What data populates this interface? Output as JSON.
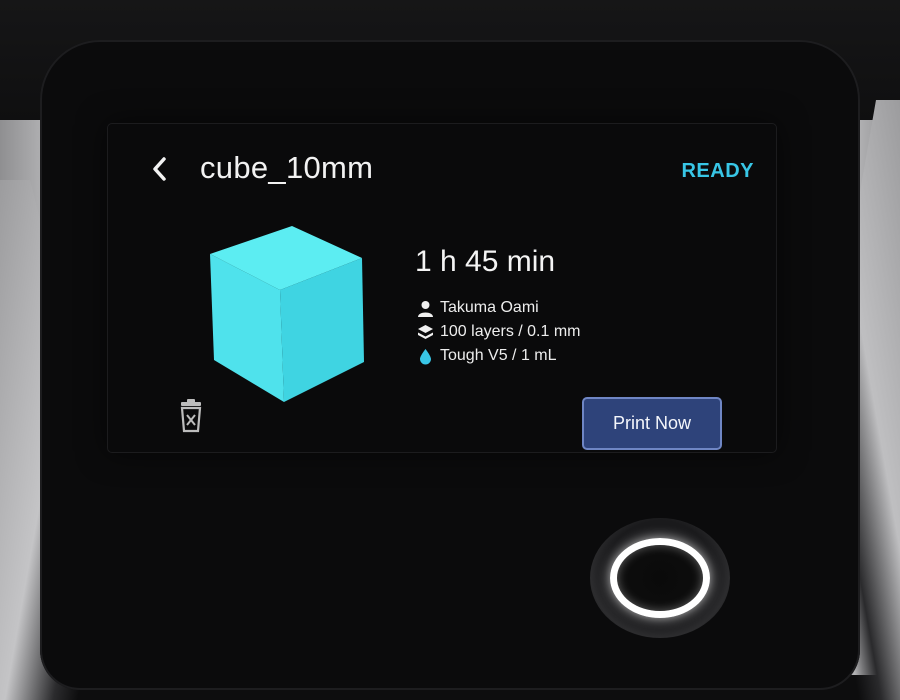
{
  "screen": {
    "title": "cube_10mm",
    "status": "READY",
    "status_color": "#38c6e6",
    "back_icon": "chevron-left-icon",
    "preview": {
      "shape": "cube",
      "color": "#4fe4ee"
    },
    "trash_icon": "trash-icon",
    "print_time": "1 h 45 min",
    "details": [
      {
        "icon": "user-icon",
        "text": "Takuma Oami"
      },
      {
        "icon": "layers-icon",
        "text": "100 layers / 0.1 mm"
      },
      {
        "icon": "droplet-icon",
        "text": "Tough V5 / 1 mL"
      }
    ],
    "print_button_label": "Print Now"
  },
  "hardware": {
    "button_icon": "ring-button"
  }
}
